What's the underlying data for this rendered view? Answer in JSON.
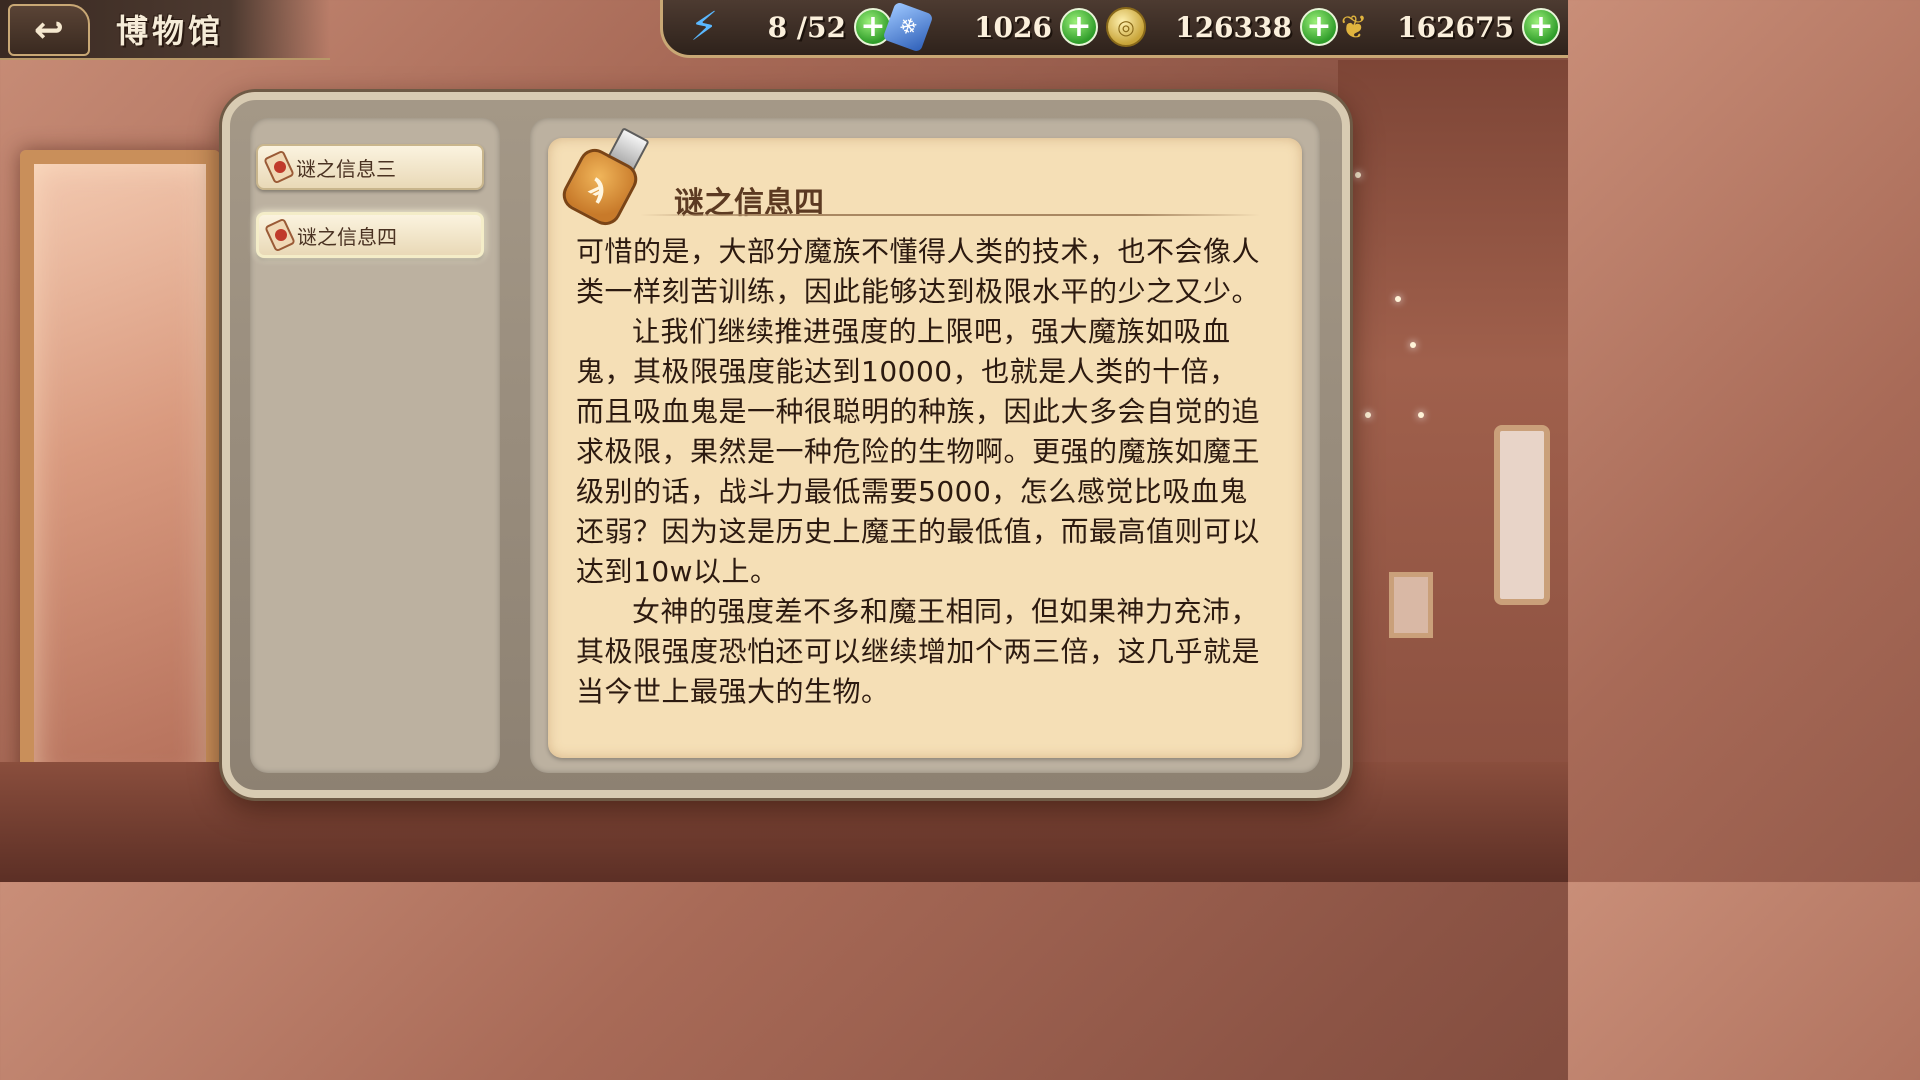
{
  "header": {
    "back_icon": "back-arrow-icon",
    "title": "博物馆"
  },
  "resources": [
    {
      "name": "energy",
      "icon": "lightning-icon",
      "value": "8 /52",
      "color": "#3aa0f0"
    },
    {
      "name": "diamond",
      "icon": "crystal-icon",
      "value": "1026",
      "color": "#4a7fd0"
    },
    {
      "name": "gold",
      "icon": "coin-icon",
      "value": "126338",
      "color": "#e2c15a"
    },
    {
      "name": "feather",
      "icon": "feather-icon",
      "value": "162675",
      "color": "#d6a93a"
    }
  ],
  "sidebar": {
    "items": [
      {
        "label": "谜之信息三",
        "active": false
      },
      {
        "label": "谜之信息四",
        "active": true
      }
    ]
  },
  "content": {
    "icon": "usb-drive-icon",
    "title": "谜之信息四",
    "paragraphs": [
      "可惜的是，大部分魔族不懂得人类的技术，也不会像人类一样刻苦训练，因此能够达到极限水平的少之又少。",
      "让我们继续推进强度的上限吧，强大魔族如吸血鬼，其极限强度能达到10000，也就是人类的十倍，而且吸血鬼是一种很聪明的种族，因此大多会自觉的追求极限，果然是一种危险的生物啊。更强的魔族如魔王级别的话，战斗力最低需要5000，怎么感觉比吸血鬼还弱？因为这是历史上魔王的最低值，而最高值则可以达到10w以上。",
      "女神的强度差不多和魔王相同，但如果神力充沛，其极限强度恐怕还可以继续增加个两三倍，这几乎就是当今世上最强大的生物。"
    ]
  },
  "colors": {
    "panel_border": "#d8cbb2",
    "paper": "#f5dfb6",
    "text": "#2c1a10",
    "title_text": "#5c3a22"
  }
}
